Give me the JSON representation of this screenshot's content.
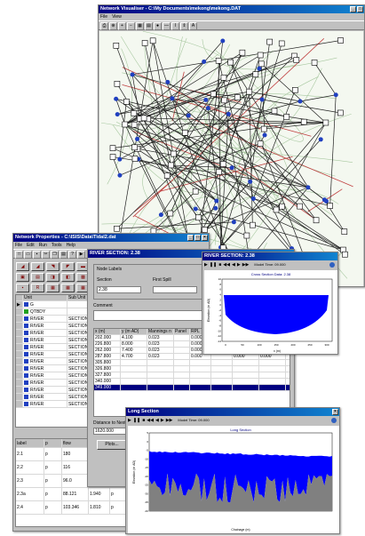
{
  "visualiser": {
    "title": "Network Visualiser - C:\\My Documents\\mekong\\mekong.DAT",
    "menu": [
      "File",
      "View"
    ],
    "toolbar_icons": [
      "print-icon",
      "zoom-fit-icon",
      "zoom-in-icon",
      "zoom-out-icon",
      "grid-icon",
      "table-icon",
      "globe-icon",
      "line-icon",
      "cursor-icon",
      "arrows-icon",
      "text-icon"
    ],
    "toolbar_glyphs": [
      "⎙",
      "⊕",
      "+",
      "−",
      "▦",
      "▤",
      "●",
      "—",
      "I",
      "⇕",
      "A"
    ]
  },
  "properties": {
    "title": "Network Properties - C:\\ISIS\\Data\\Tidal2.dat",
    "menu": [
      "File",
      "Edit",
      "Run",
      "Tools",
      "Help"
    ],
    "columns": {
      "unit": "Unit",
      "subunit": "Sub Unit"
    },
    "units": [
      {
        "unit": "G",
        "sub": ""
      },
      {
        "unit": "QTBDY",
        "sub": ""
      },
      {
        "unit": "RIVER",
        "sub": "SECTION"
      },
      {
        "unit": "RIVER",
        "sub": "SECTION"
      },
      {
        "unit": "RIVER",
        "sub": "SECTION"
      },
      {
        "unit": "RIVER",
        "sub": "SECTION"
      },
      {
        "unit": "RIVER",
        "sub": "SECTION"
      },
      {
        "unit": "RIVER",
        "sub": "SECTION"
      },
      {
        "unit": "RIVER",
        "sub": "SECTION"
      },
      {
        "unit": "RIVER",
        "sub": "SECTION"
      },
      {
        "unit": "RIVER",
        "sub": "SECTION"
      },
      {
        "unit": "RIVER",
        "sub": "SECTION"
      },
      {
        "unit": "RIVER",
        "sub": "SECTION"
      },
      {
        "unit": "RIVER",
        "sub": "SECTION"
      },
      {
        "unit": "RIVER",
        "sub": "SECTION"
      }
    ],
    "lower_columns": {
      "label": "label",
      "p1": "p",
      "flow": "flow",
      "p2": "p",
      "stage": "p"
    },
    "lower_rows": [
      {
        "label": "2.1",
        "p": "p",
        "flow": "180",
        "p2": "",
        "stage": ""
      },
      {
        "label": "2.2",
        "p": "p",
        "flow": "116",
        "p2": "",
        "stage": ""
      },
      {
        "label": "2.3",
        "p": "p",
        "flow": "96.0",
        "p2": "",
        "stage": ""
      },
      {
        "label": "2.3a",
        "p": "p",
        "flow": "88.121",
        "p2": "1.940",
        "stage": "p"
      },
      {
        "label": "2.4",
        "p": "p",
        "flow": "103.346",
        "p2": "1.810",
        "stage": "p"
      }
    ]
  },
  "river_section": {
    "title": "RIVER SECTION: 2.38",
    "node_labels": "Node Labels",
    "section_lbl": "Section",
    "first_spill_lbl": "First Spill",
    "section_val": "2.38",
    "comment_lbl": "Comment",
    "columns": [
      "x (m)",
      "y (m AD)",
      "Mannings n",
      "Panel",
      "RPL",
      "Marker",
      "Easting",
      "Northing"
    ],
    "rows": [
      [
        "202.000",
        "4.100",
        "0.023",
        "",
        "0.000",
        "",
        "0.000",
        "0.000"
      ],
      [
        "226.800",
        "8.000",
        "0.023",
        "",
        "0.000",
        "",
        "0.000",
        "0.000"
      ],
      [
        "262.000",
        "7.400",
        "0.023",
        "",
        "0.000",
        "",
        "0.000",
        "0.000"
      ],
      [
        "287.800",
        "4.700",
        "0.023",
        "",
        "0.000",
        "",
        "0.000",
        "0.000"
      ],
      [
        "305.800",
        "",
        "",
        "",
        "",
        "",
        "",
        ""
      ],
      [
        "326.800",
        "",
        "",
        "",
        "",
        "",
        "",
        ""
      ],
      [
        "327.800",
        "",
        "",
        "",
        "",
        "",
        "",
        ""
      ],
      [
        "340.000",
        "",
        "",
        "",
        "",
        "",
        "",
        ""
      ],
      [
        "349.000",
        "",
        "",
        "",
        "",
        "",
        "",
        ""
      ]
    ],
    "distance_lbl": "Distance to Next",
    "distance_val": "1620.000",
    "button": "Plots..."
  },
  "cross_section": {
    "title": "RIVER SECTION: 2.38",
    "time_label": "Model Time: 09.000",
    "chart_title": "Cross Section Data: 2.38",
    "ylabel": "Elevation (m AD)",
    "xlabel": "x (m)",
    "xticks": [
      "0",
      "50",
      "100",
      "150",
      "200",
      "250",
      "300"
    ],
    "yticks": [
      "10",
      "8",
      "6",
      "4",
      "2",
      "0",
      "-2",
      "-4",
      "-6",
      "-8",
      "-10",
      "-12",
      "-14"
    ]
  },
  "long_section": {
    "title": "Long Section",
    "time_label": "Model Time: 09.000",
    "chart_title": "Long Section",
    "ylabel": "Elevation (m AD)",
    "xlabel": "Chainage (m)",
    "yticks": [
      "5",
      "0",
      "-5",
      "-10",
      "-15",
      "-20",
      "-25",
      "-30",
      "-35",
      "-40"
    ]
  },
  "colors": {
    "title_active": "#000080",
    "water": "#0000ff",
    "bed": "#808080",
    "map_road": "#c04040",
    "node": "#2040c0"
  }
}
